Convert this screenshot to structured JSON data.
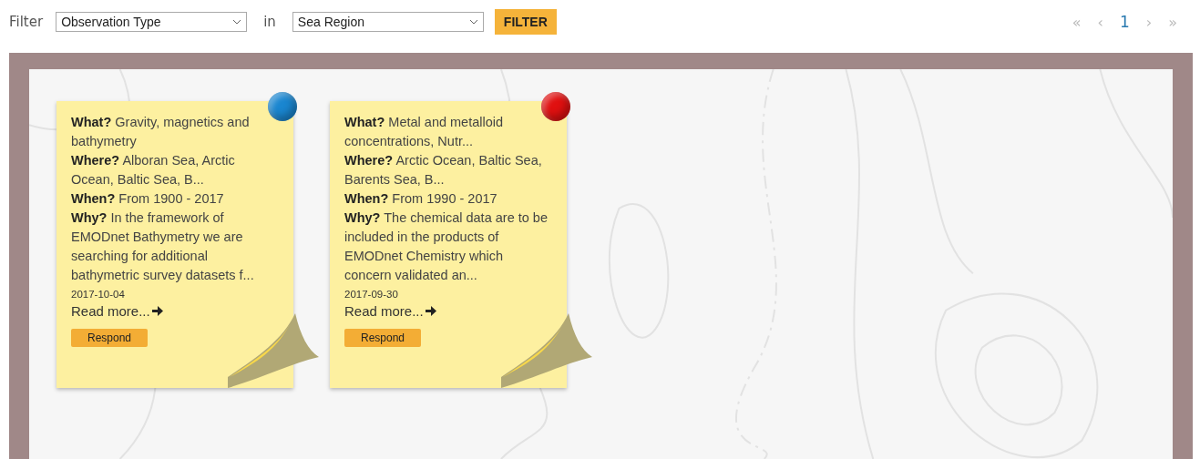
{
  "filter": {
    "label": "Filter",
    "type_select": "Observation Type",
    "joiner": "in",
    "region_select": "Sea Region",
    "button": "FILTER"
  },
  "pagination": [
    {
      "label": "«",
      "selected": false
    },
    {
      "label": "‹",
      "selected": false
    },
    {
      "label": "1",
      "selected": true
    },
    {
      "label": "›",
      "selected": false
    },
    {
      "label": "»",
      "selected": false
    }
  ],
  "notes": [
    {
      "color": "#1a86d0",
      "fields": [
        "**What?** Gravity, magnetics and bathymetry",
        "**Where?** Alboran Sea, Arctic Ocean, Baltic Sea, B...",
        "**When?** From 1900 - 2017",
        "**Why?** In the framework of EMODnet Bathymetry we are searching for additional bathymetric survey datasets f..."
      ],
      "date": "2017-10-04",
      "read_more": "Read more...",
      "button": "Respond"
    },
    {
      "color": "#e01010",
      "fields": [
        "**What?** Metal and metalloid concentrations, Nutr...",
        "**Where?** Arctic Ocean, Baltic Sea, Barents Sea, B...",
        "**When?** From 1990 - 2017",
        "**Why?** The chemical data are to be included in the products of EMODnet Chemistry which concern validated an..."
      ],
      "date": "2017-09-30",
      "read_more": "Read more...",
      "button": "Respond"
    }
  ]
}
